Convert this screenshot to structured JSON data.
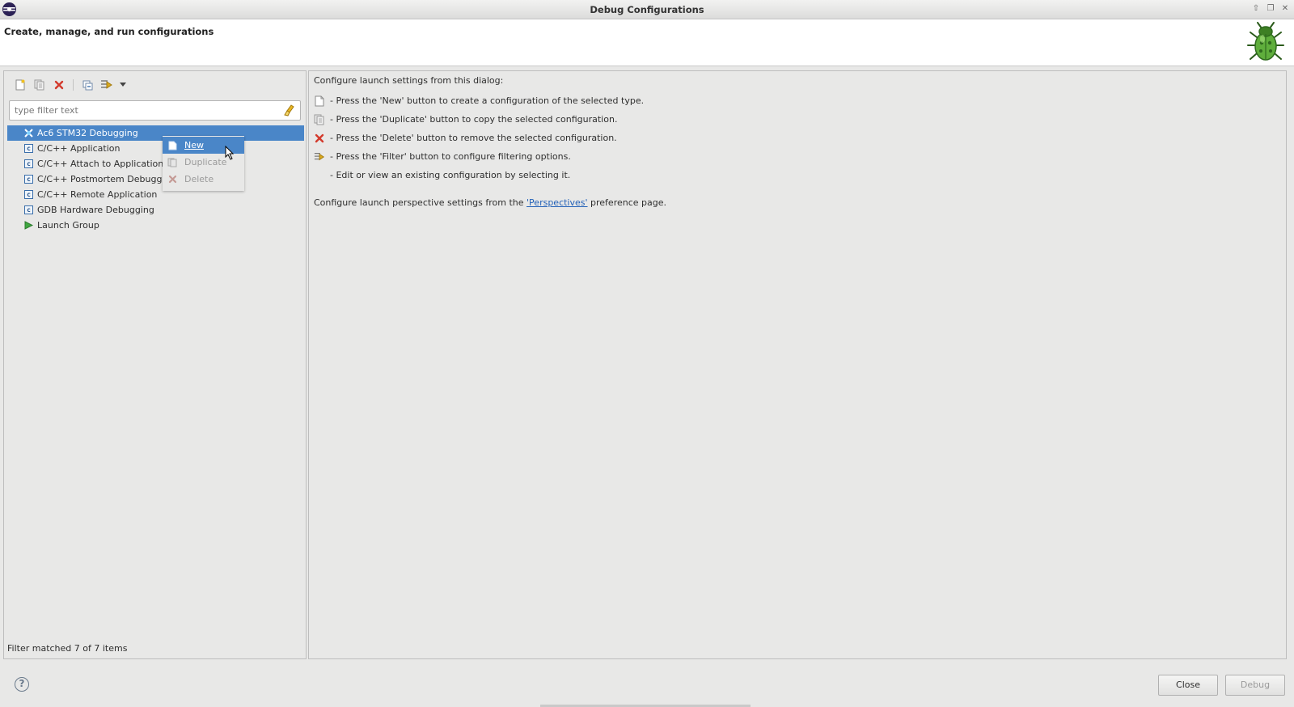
{
  "window": {
    "title": "Debug Configurations",
    "controls": [
      {
        "icon": "maximize-up-icon",
        "glyph": "⇧"
      },
      {
        "icon": "restore-icon",
        "glyph": "❐"
      },
      {
        "icon": "close-icon",
        "glyph": "✕"
      }
    ]
  },
  "header": {
    "title": "Create, manage, and run configurations",
    "icon": "debug-bug-icon"
  },
  "toolbar": {
    "buttons": [
      "new-configuration-icon",
      "duplicate-icon",
      "delete-icon",
      "collapse-all-icon",
      "filter-icon",
      "view-menu-dropdown-icon"
    ]
  },
  "filter": {
    "placeholder": "type filter text",
    "value": ""
  },
  "tree": {
    "items": [
      {
        "label": "Ac6 STM32 Debugging",
        "icon": "stm32-debug-icon",
        "selected": true
      },
      {
        "label": "C/C++ Application",
        "icon": "c-app-icon"
      },
      {
        "label": "C/C++ Attach to Application",
        "icon": "c-app-icon"
      },
      {
        "label": "C/C++ Postmortem Debugger",
        "icon": "c-app-icon"
      },
      {
        "label": "C/C++ Remote Application",
        "icon": "c-app-icon"
      },
      {
        "label": "GDB Hardware Debugging",
        "icon": "c-app-icon"
      },
      {
        "label": "Launch Group",
        "icon": "launch-group-icon"
      }
    ]
  },
  "context_menu": {
    "items": [
      {
        "label": "New",
        "state": "active"
      },
      {
        "label": "Duplicate",
        "state": "disabled"
      },
      {
        "label": "Delete",
        "state": "disabled"
      }
    ]
  },
  "status": {
    "text": "Filter matched 7 of 7 items"
  },
  "instructions": {
    "intro": "Configure launch settings from this dialog:",
    "lines": [
      {
        "icon": "new-configuration-icon",
        "text": "- Press the 'New' button to create a configuration of the selected type."
      },
      {
        "icon": "duplicate-icon",
        "text": "- Press the 'Duplicate' button to copy the selected configuration."
      },
      {
        "icon": "delete-icon",
        "text": "- Press the 'Delete' button to remove the selected configuration."
      },
      {
        "icon": "filter-icon",
        "text": "- Press the 'Filter' button to configure filtering options."
      },
      {
        "icon": "",
        "text": "- Edit or view an existing configuration by selecting it."
      }
    ],
    "perspectives_prefix": "Configure launch perspective settings from the ",
    "perspectives_link": "'Perspectives'",
    "perspectives_suffix": " preference page."
  },
  "buttons": {
    "help": "?",
    "close": "Close",
    "debug": "Debug"
  },
  "colors": {
    "selection": "#4a86c8",
    "link": "#2462b8",
    "delete_red": "#d33a2c"
  }
}
